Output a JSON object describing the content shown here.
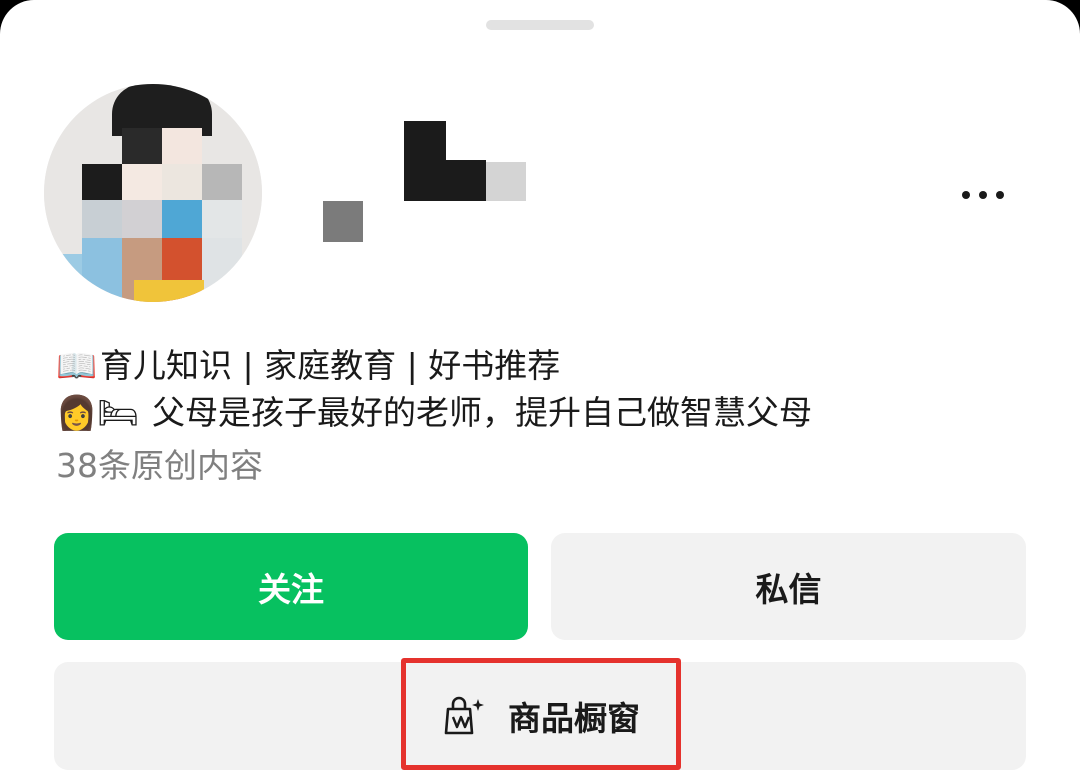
{
  "profile": {
    "bio_line1": "育儿知识 | 家庭教育 | 好书推荐",
    "bio_line1_emoji": "📖",
    "bio_line2": "父母是孩子最好的老师，提升自己做智慧父母",
    "bio_line2_emoji": "👩🛏",
    "original_count": "38条原创内容"
  },
  "actions": {
    "follow_label": "关注",
    "message_label": "私信",
    "shop_label": "商品橱窗"
  },
  "colors": {
    "follow_bg": "#07c160",
    "secondary_bg": "#f2f2f2",
    "highlight": "#e5322d"
  },
  "icons": {
    "more": "more-icon",
    "shop": "shopping-bag-icon"
  }
}
